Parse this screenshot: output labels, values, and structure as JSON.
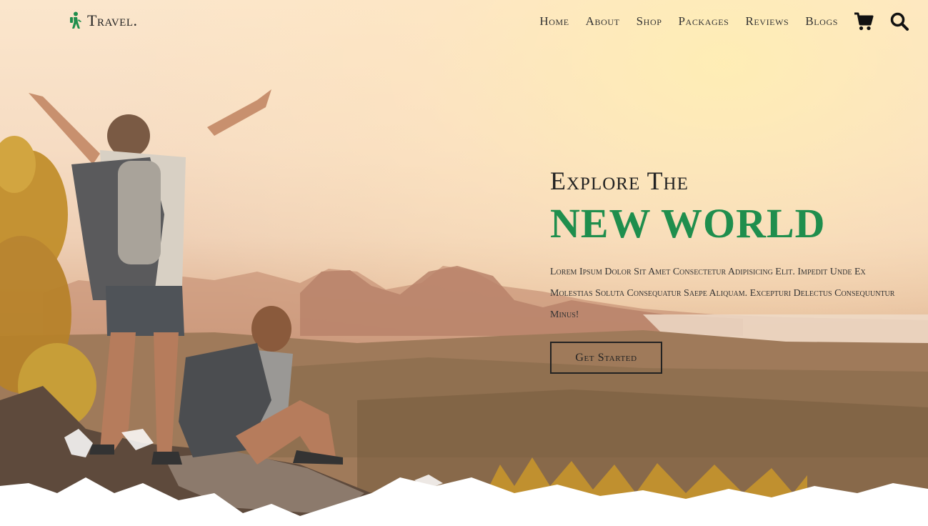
{
  "brand": {
    "name": "Travel.",
    "icon": "hiker-icon",
    "accent": "#1f8e4d"
  },
  "nav": {
    "items": [
      {
        "label": "Home"
      },
      {
        "label": "About"
      },
      {
        "label": "Shop"
      },
      {
        "label": "Packages"
      },
      {
        "label": "Reviews"
      },
      {
        "label": "Blogs"
      }
    ],
    "cart_icon": "cart-icon",
    "search_icon": "search-icon"
  },
  "hero": {
    "eyebrow": "Explore The",
    "headline": "NEW WORLD",
    "description": "Lorem Ipsum Dolor Sit Amet Consectetur Adipisicing Elit. Impedit Unde Ex Molestias Soluta Consequatur Saepe Aliquam. Excepturi Delectus Consequuntur Minus!",
    "cta_label": "Get Started",
    "background": "hikers-on-cliff-photo"
  }
}
